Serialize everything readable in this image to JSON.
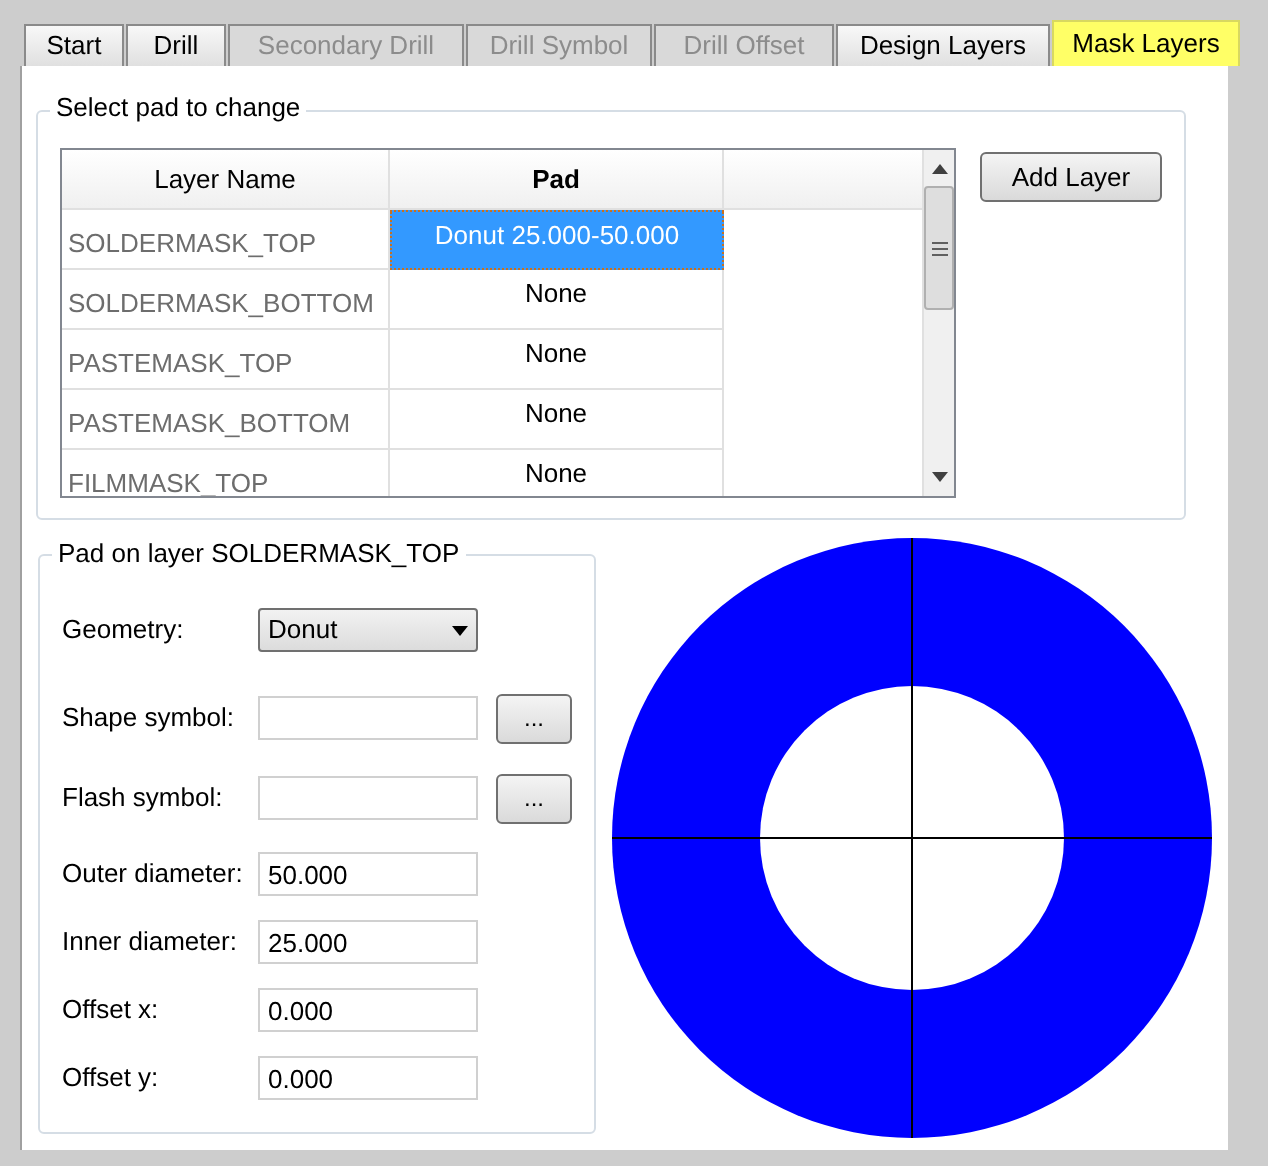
{
  "tabs": [
    {
      "label": "Start",
      "selected": false,
      "disabled": false
    },
    {
      "label": "Drill",
      "selected": false,
      "disabled": false
    },
    {
      "label": "Secondary Drill",
      "selected": false,
      "disabled": true
    },
    {
      "label": "Drill Symbol",
      "selected": false,
      "disabled": true
    },
    {
      "label": "Drill Offset",
      "selected": false,
      "disabled": true
    },
    {
      "label": "Design Layers",
      "selected": false,
      "disabled": false
    },
    {
      "label": "Mask Layers",
      "selected": true,
      "disabled": false
    }
  ],
  "pad_group": {
    "title": "Select pad to change",
    "columns": [
      "Layer Name",
      "Pad"
    ],
    "rows": [
      {
        "layer": "SOLDERMASK_TOP",
        "pad": "Donut 25.000-50.000",
        "selected": true
      },
      {
        "layer": "SOLDERMASK_BOTTOM",
        "pad": "None",
        "selected": false
      },
      {
        "layer": "PASTEMASK_TOP",
        "pad": "None",
        "selected": false
      },
      {
        "layer": "PASTEMASK_BOTTOM",
        "pad": "None",
        "selected": false
      },
      {
        "layer": "FILMMASK_TOP",
        "pad": "None",
        "selected": false
      }
    ],
    "add_button": "Add Layer"
  },
  "layer_group": {
    "title": "Pad on layer SOLDERMASK_TOP",
    "fields": [
      {
        "kind": "select",
        "label": "Geometry:",
        "value": "Donut"
      },
      {
        "kind": "browse",
        "label": "Shape symbol:",
        "button": "..."
      },
      {
        "kind": "browse",
        "label": "Flash symbol:",
        "button": "..."
      },
      {
        "kind": "text",
        "label": "Outer diameter:",
        "value": "50.000"
      },
      {
        "kind": "text",
        "label": "Inner diameter:",
        "value": "25.000"
      },
      {
        "kind": "text",
        "label": "Offset x:",
        "value": "0.000"
      },
      {
        "kind": "text",
        "label": "Offset y:",
        "value": "0.000"
      }
    ]
  }
}
